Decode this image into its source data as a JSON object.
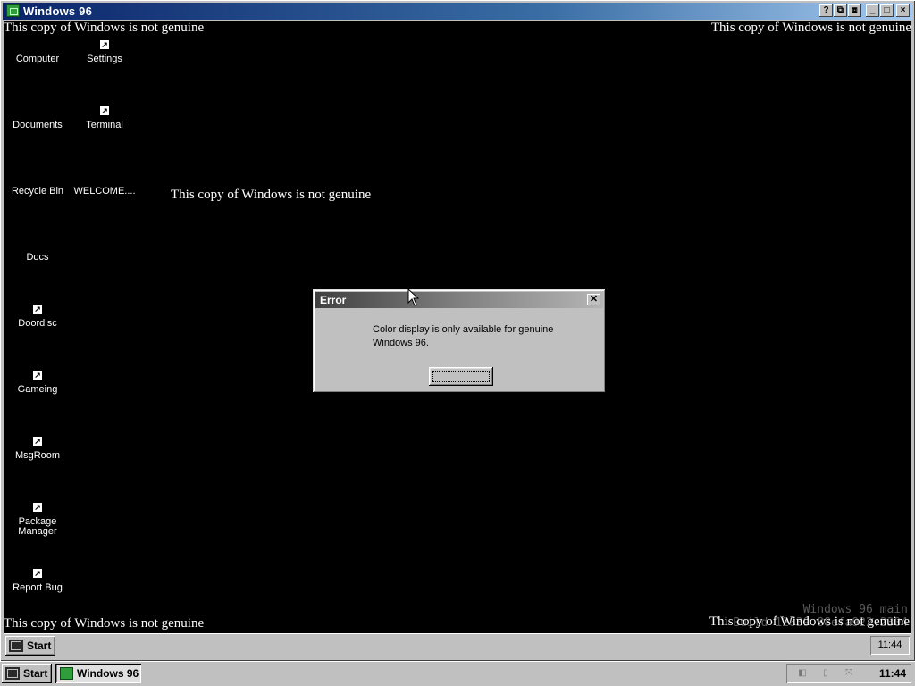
{
  "host_window": {
    "title": "Windows 96",
    "controls": [
      "?",
      "⧉",
      "⧈",
      "_",
      "□",
      "×"
    ]
  },
  "desktop": {
    "watermark_text": "This copy of Windows is not genuine",
    "build_line1": "Windows 96 main",
    "build_line2": "Build 12839.88efa922.2304",
    "icons": [
      {
        "label": "Computer",
        "shortcut": false
      },
      {
        "label": "Settings",
        "shortcut": true
      },
      {
        "label": "Documents",
        "shortcut": false
      },
      {
        "label": "Terminal",
        "shortcut": true
      },
      {
        "label": "Recycle Bin",
        "shortcut": false
      },
      {
        "label": "WELCOME....",
        "shortcut": false
      },
      {
        "label": "Docs",
        "shortcut": false
      },
      {
        "label": "Doordisc",
        "shortcut": true
      },
      {
        "label": "Gameing",
        "shortcut": true
      },
      {
        "label": "MsgRoom",
        "shortcut": true
      },
      {
        "label": "Package Manager",
        "shortcut": true
      },
      {
        "label": "Report Bug",
        "shortcut": true
      }
    ]
  },
  "dialog": {
    "title": "Error",
    "close_glyph": "✕",
    "message": "Color display is only available for genuine Windows 96.",
    "ok_label": ""
  },
  "guest_taskbar": {
    "start_label": "Start",
    "clock": "11:44"
  },
  "host_taskbar": {
    "start_label": "Start",
    "task_label": "Windows 96",
    "clock": "11:44"
  }
}
